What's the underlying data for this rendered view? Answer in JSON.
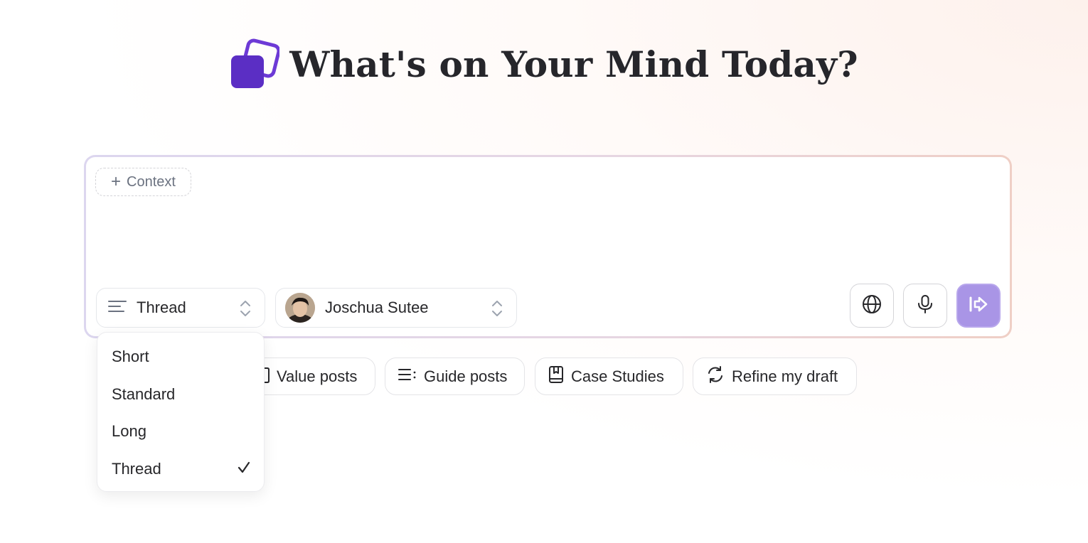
{
  "header": {
    "title": "What's on Your Mind Today?",
    "logo_icon": "stacked-squares-logo",
    "logo_color_front": "#5b2ec4",
    "logo_color_back": "#6d3ad6"
  },
  "composer": {
    "context_chip_label": "Context",
    "input_value": "",
    "length_select": {
      "value": "Thread",
      "icon": "align-left-icon"
    },
    "author_select": {
      "value": "Joschua Sutee",
      "icon": "avatar"
    },
    "actions": [
      {
        "name": "globe-button",
        "icon": "globe-icon"
      },
      {
        "name": "mic-button",
        "icon": "microphone-icon"
      },
      {
        "name": "send-button",
        "icon": "send-arrow-icon",
        "color": "#a995e6"
      }
    ]
  },
  "suggestions": [
    {
      "label": "Value posts",
      "icon": "clipboard-icon"
    },
    {
      "label": "Guide posts",
      "icon": "list-icon"
    },
    {
      "label": "Case Studies",
      "icon": "book-icon"
    },
    {
      "label": "Refine my draft",
      "icon": "refresh-icon"
    }
  ],
  "length_dropdown": {
    "options": [
      "Short",
      "Standard",
      "Long",
      "Thread"
    ],
    "selected": "Thread"
  }
}
